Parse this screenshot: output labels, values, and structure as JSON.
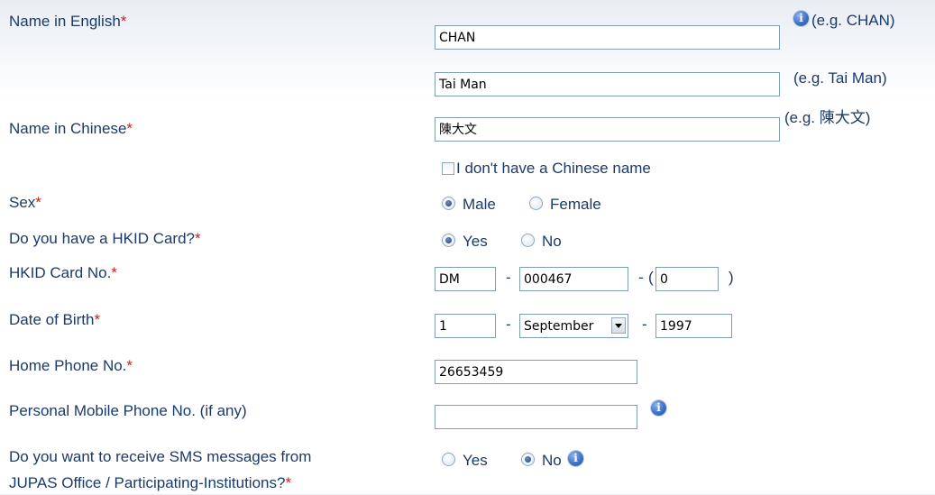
{
  "fields": {
    "name_english": {
      "label": "Name in English",
      "surname": "CHAN",
      "surname_hint": "(e.g. CHAN)",
      "given": "Tai Man",
      "given_hint": "(e.g. Tai Man)"
    },
    "name_chinese": {
      "label": "Name in Chinese",
      "value": "陳大文",
      "hint": "(e.g. 陳大文)",
      "no_chinese_checkbox_label": "I don't have a Chinese name"
    },
    "sex": {
      "label": "Sex",
      "options": [
        "Male",
        "Female"
      ],
      "selected": "Male"
    },
    "hkid_have": {
      "label": "Do you have a HKID Card?",
      "options": [
        "Yes",
        "No"
      ],
      "selected": "Yes"
    },
    "hkid_no": {
      "label": "HKID Card No.",
      "part1": "DM",
      "part2": "000467",
      "check_digit": "0"
    },
    "dob": {
      "label": "Date of Birth",
      "day": "1",
      "month": "September",
      "year": "1997"
    },
    "home_phone": {
      "label": "Home Phone No.",
      "value": "26653459"
    },
    "mobile_phone": {
      "label": "Personal Mobile Phone No. (if any)",
      "value": ""
    },
    "sms": {
      "label_line1": "Do you want to receive SMS messages from",
      "label_line2": "JUPAS Office / Participating-Institutions?",
      "options": [
        "Yes",
        "No"
      ],
      "selected": "No"
    }
  },
  "symbols": {
    "required": "*",
    "dash": "-",
    "paren_open": "(",
    "paren_close": ")"
  }
}
